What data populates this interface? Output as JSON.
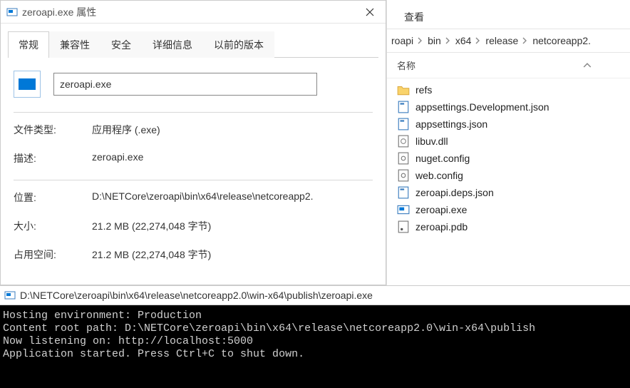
{
  "properties_dialog": {
    "title": "zeroapi.exe 属性",
    "tabs": [
      "常规",
      "兼容性",
      "安全",
      "详细信息",
      "以前的版本"
    ],
    "active_tab_index": 0,
    "filename": "zeroapi.exe",
    "rows": [
      {
        "label": "文件类型:",
        "value": "应用程序 (.exe)"
      },
      {
        "label": "描述:",
        "value": "zeroapi.exe"
      }
    ],
    "rows2": [
      {
        "label": "位置:",
        "value": "D:\\NETCore\\zeroapi\\bin\\x64\\release\\netcoreapp2."
      },
      {
        "label": "大小:",
        "value": "21.2 MB (22,274,048 字节)"
      },
      {
        "label": "占用空间:",
        "value": "21.2 MB (22,274,048 字节)"
      }
    ]
  },
  "explorer": {
    "menu_item": "查看",
    "breadcrumb": [
      "roapi",
      "bin",
      "x64",
      "release",
      "netcoreapp2."
    ],
    "header_name": "名称",
    "files": [
      {
        "icon": "folder",
        "name": "refs"
      },
      {
        "icon": "json",
        "name": "appsettings.Development.json"
      },
      {
        "icon": "json",
        "name": "appsettings.json"
      },
      {
        "icon": "dll",
        "name": "libuv.dll"
      },
      {
        "icon": "config",
        "name": "nuget.config"
      },
      {
        "icon": "config",
        "name": "web.config"
      },
      {
        "icon": "json",
        "name": "zeroapi.deps.json"
      },
      {
        "icon": "exe",
        "name": "zeroapi.exe"
      },
      {
        "icon": "pdb",
        "name": "zeroapi.pdb"
      }
    ]
  },
  "console": {
    "title": "D:\\NETCore\\zeroapi\\bin\\x64\\release\\netcoreapp2.0\\win-x64\\publish\\zeroapi.exe",
    "lines": [
      "Hosting environment: Production",
      "Content root path: D:\\NETCore\\zeroapi\\bin\\x64\\release\\netcoreapp2.0\\win-x64\\publish",
      "Now listening on: http://localhost:5000",
      "Application started. Press Ctrl+C to shut down."
    ]
  }
}
